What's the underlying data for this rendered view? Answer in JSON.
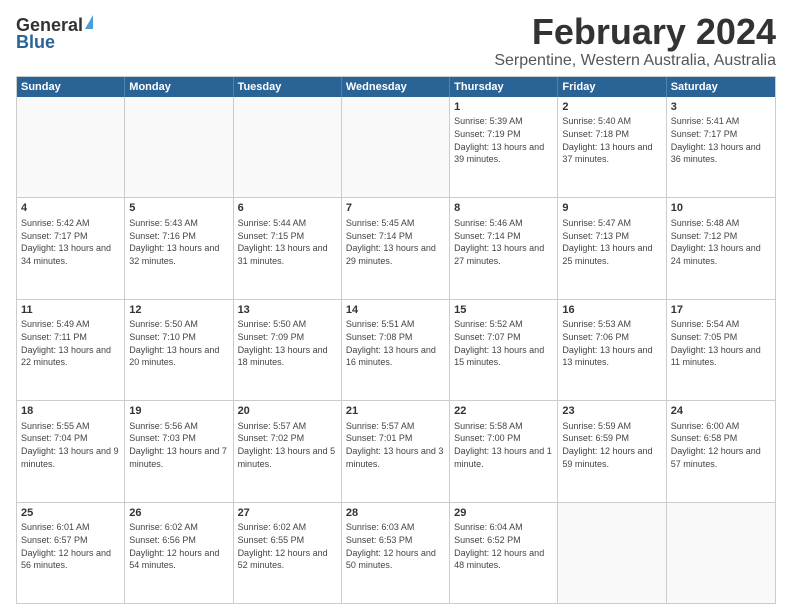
{
  "logo": {
    "general": "General",
    "blue": "Blue"
  },
  "header": {
    "title": "February 2024",
    "subtitle": "Serpentine, Western Australia, Australia"
  },
  "days": [
    "Sunday",
    "Monday",
    "Tuesday",
    "Wednesday",
    "Thursday",
    "Friday",
    "Saturday"
  ],
  "weeks": [
    {
      "cells": [
        {
          "empty": true
        },
        {
          "empty": true
        },
        {
          "empty": true
        },
        {
          "empty": true
        },
        {
          "day": 1,
          "sunrise": "5:39 AM",
          "sunset": "7:19 PM",
          "daylight": "13 hours and 39 minutes."
        },
        {
          "day": 2,
          "sunrise": "5:40 AM",
          "sunset": "7:18 PM",
          "daylight": "13 hours and 37 minutes."
        },
        {
          "day": 3,
          "sunrise": "5:41 AM",
          "sunset": "7:17 PM",
          "daylight": "13 hours and 36 minutes."
        }
      ]
    },
    {
      "cells": [
        {
          "day": 4,
          "sunrise": "5:42 AM",
          "sunset": "7:17 PM",
          "daylight": "13 hours and 34 minutes."
        },
        {
          "day": 5,
          "sunrise": "5:43 AM",
          "sunset": "7:16 PM",
          "daylight": "13 hours and 32 minutes."
        },
        {
          "day": 6,
          "sunrise": "5:44 AM",
          "sunset": "7:15 PM",
          "daylight": "13 hours and 31 minutes."
        },
        {
          "day": 7,
          "sunrise": "5:45 AM",
          "sunset": "7:14 PM",
          "daylight": "13 hours and 29 minutes."
        },
        {
          "day": 8,
          "sunrise": "5:46 AM",
          "sunset": "7:14 PM",
          "daylight": "13 hours and 27 minutes."
        },
        {
          "day": 9,
          "sunrise": "5:47 AM",
          "sunset": "7:13 PM",
          "daylight": "13 hours and 25 minutes."
        },
        {
          "day": 10,
          "sunrise": "5:48 AM",
          "sunset": "7:12 PM",
          "daylight": "13 hours and 24 minutes."
        }
      ]
    },
    {
      "cells": [
        {
          "day": 11,
          "sunrise": "5:49 AM",
          "sunset": "7:11 PM",
          "daylight": "13 hours and 22 minutes."
        },
        {
          "day": 12,
          "sunrise": "5:50 AM",
          "sunset": "7:10 PM",
          "daylight": "13 hours and 20 minutes."
        },
        {
          "day": 13,
          "sunrise": "5:50 AM",
          "sunset": "7:09 PM",
          "daylight": "13 hours and 18 minutes."
        },
        {
          "day": 14,
          "sunrise": "5:51 AM",
          "sunset": "7:08 PM",
          "daylight": "13 hours and 16 minutes."
        },
        {
          "day": 15,
          "sunrise": "5:52 AM",
          "sunset": "7:07 PM",
          "daylight": "13 hours and 15 minutes."
        },
        {
          "day": 16,
          "sunrise": "5:53 AM",
          "sunset": "7:06 PM",
          "daylight": "13 hours and 13 minutes."
        },
        {
          "day": 17,
          "sunrise": "5:54 AM",
          "sunset": "7:05 PM",
          "daylight": "13 hours and 11 minutes."
        }
      ]
    },
    {
      "cells": [
        {
          "day": 18,
          "sunrise": "5:55 AM",
          "sunset": "7:04 PM",
          "daylight": "13 hours and 9 minutes."
        },
        {
          "day": 19,
          "sunrise": "5:56 AM",
          "sunset": "7:03 PM",
          "daylight": "13 hours and 7 minutes."
        },
        {
          "day": 20,
          "sunrise": "5:57 AM",
          "sunset": "7:02 PM",
          "daylight": "13 hours and 5 minutes."
        },
        {
          "day": 21,
          "sunrise": "5:57 AM",
          "sunset": "7:01 PM",
          "daylight": "13 hours and 3 minutes."
        },
        {
          "day": 22,
          "sunrise": "5:58 AM",
          "sunset": "7:00 PM",
          "daylight": "13 hours and 1 minute."
        },
        {
          "day": 23,
          "sunrise": "5:59 AM",
          "sunset": "6:59 PM",
          "daylight": "12 hours and 59 minutes."
        },
        {
          "day": 24,
          "sunrise": "6:00 AM",
          "sunset": "6:58 PM",
          "daylight": "12 hours and 57 minutes."
        }
      ]
    },
    {
      "cells": [
        {
          "day": 25,
          "sunrise": "6:01 AM",
          "sunset": "6:57 PM",
          "daylight": "12 hours and 56 minutes."
        },
        {
          "day": 26,
          "sunrise": "6:02 AM",
          "sunset": "6:56 PM",
          "daylight": "12 hours and 54 minutes."
        },
        {
          "day": 27,
          "sunrise": "6:02 AM",
          "sunset": "6:55 PM",
          "daylight": "12 hours and 52 minutes."
        },
        {
          "day": 28,
          "sunrise": "6:03 AM",
          "sunset": "6:53 PM",
          "daylight": "12 hours and 50 minutes."
        },
        {
          "day": 29,
          "sunrise": "6:04 AM",
          "sunset": "6:52 PM",
          "daylight": "12 hours and 48 minutes."
        },
        {
          "empty": true
        },
        {
          "empty": true
        }
      ]
    }
  ],
  "labels": {
    "sunrise_prefix": "Sunrise: ",
    "sunset_prefix": "Sunset: ",
    "daylight_prefix": "Daylight: "
  }
}
